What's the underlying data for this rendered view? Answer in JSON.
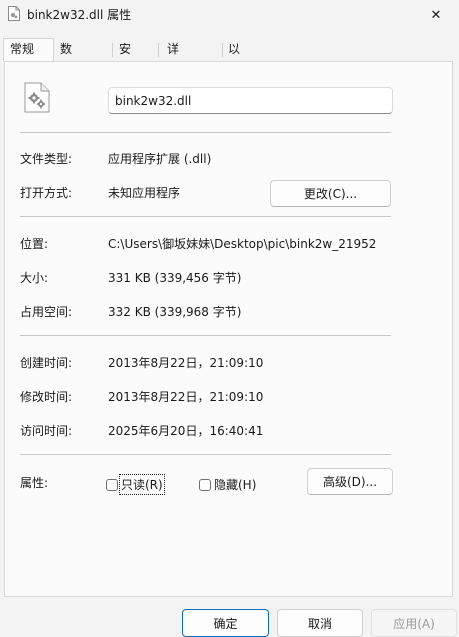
{
  "window": {
    "title": "bink2w32.dll 属性",
    "close_symbol": "✕"
  },
  "tabs": [
    {
      "label": "常规"
    },
    {
      "label": "数字签名"
    },
    {
      "label": "安全"
    },
    {
      "label": "详细信息"
    },
    {
      "label": "以前的版本"
    }
  ],
  "general": {
    "file_name": "bink2w32.dll",
    "file_type_label": "文件类型:",
    "file_type_value": "应用程序扩展 (.dll)",
    "opens_with_label": "打开方式:",
    "opens_with_value": "未知应用程序",
    "change_button": "更改(C)...",
    "location_label": "位置:",
    "location_value": "C:\\Users\\御坂妹妹\\Desktop\\pic\\bink2w_21952",
    "size_label": "大小:",
    "size_value": "331 KB (339,456 字节)",
    "size_on_disk_label": "占用空间:",
    "size_on_disk_value": "332 KB (339,968 字节)",
    "created_label": "创建时间:",
    "created_value": "2013年8月22日，21:09:10",
    "modified_label": "修改时间:",
    "modified_value": "2013年8月22日，21:09:10",
    "accessed_label": "访问时间:",
    "accessed_value": "2025年6月20日，16:40:41",
    "attributes_label": "属性:",
    "readonly_label": "只读(R)",
    "hidden_label": "隐藏(H)",
    "advanced_button": "高级(D)..."
  },
  "footer": {
    "ok": "确定",
    "cancel": "取消",
    "apply": "应用(A)"
  },
  "colors": {
    "accent": "#0f6cbd",
    "window_bg": "#f3f3f3",
    "panel_bg": "#fbfbfb"
  },
  "icons": {
    "title": "dll-file-icon",
    "file": "settings-file-icon",
    "close": "close-icon"
  }
}
